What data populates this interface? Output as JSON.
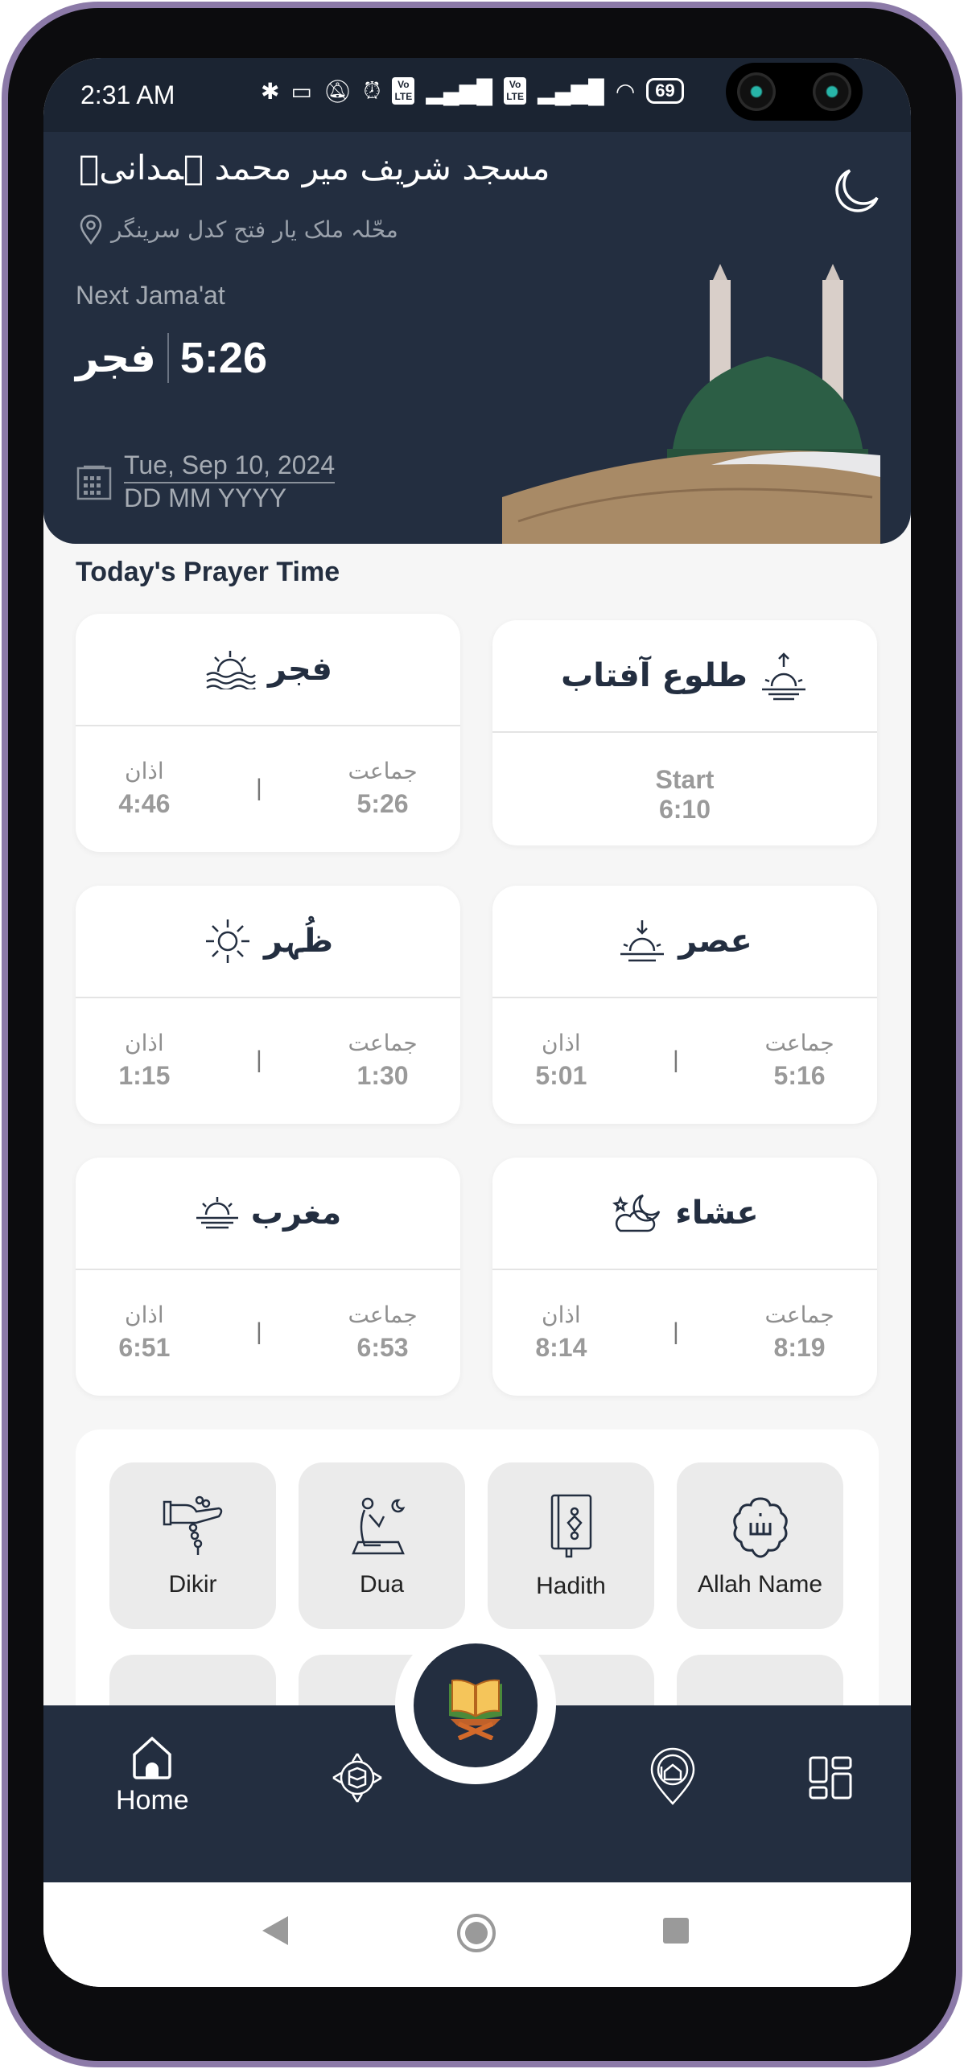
{
  "status_bar": {
    "time": "2:31 AM",
    "battery": "69",
    "volte": "Vo LTE"
  },
  "header": {
    "mosque_name": "مسجد شریف میر محمد ہمدانیؒ",
    "location": "محّلہ ملک یار فتح  کدل سرینگر",
    "next_label": "Next Jama'at",
    "next_prayer": "فجر",
    "next_time": "5:26",
    "date": "Tue, Sep 10, 2024",
    "date_format": "DD MM YYYY",
    "theme_icon": "moon-icon"
  },
  "section_title": "Today's Prayer Time",
  "prayers": [
    {
      "name": "فجر",
      "icon": "sunrise-waves-icon",
      "adhan_label": "اذان",
      "adhan": "4:46",
      "jamaat_label": "جماعت",
      "jamaat": "5:26"
    },
    {
      "name": "طلوع آفتاب",
      "icon": "sunrise-arrow-icon",
      "start_label": "Start",
      "start": "6:10"
    },
    {
      "name": "ظُہر",
      "icon": "sun-icon",
      "adhan_label": "اذان",
      "adhan": "1:15",
      "jamaat_label": "جماعت",
      "jamaat": "1:30"
    },
    {
      "name": "عصر",
      "icon": "sunset-arrow-icon",
      "adhan_label": "اذان",
      "adhan": "5:01",
      "jamaat_label": "جماعت",
      "jamaat": "5:16"
    },
    {
      "name": "مغرب",
      "icon": "sunset-icon",
      "adhan_label": "اذان",
      "adhan": "6:51",
      "jamaat_label": "جماعت",
      "jamaat": "6:53"
    },
    {
      "name": "عشاء",
      "icon": "moon-stars-cloud-icon",
      "adhan_label": "اذان",
      "adhan": "8:14",
      "jamaat_label": "جماعت",
      "jamaat": "8:19"
    }
  ],
  "features": [
    {
      "label": "Dikir",
      "icon": "tasbih-hand-icon"
    },
    {
      "label": "Dua",
      "icon": "praying-person-icon"
    },
    {
      "label": "Hadith",
      "icon": "book-icon"
    },
    {
      "label": "Allah Name",
      "icon": "allah-calligraphy-icon"
    }
  ],
  "bottom_nav": {
    "home_label": "Home",
    "items": [
      "home-icon",
      "qibla-compass-icon",
      "quran-icon",
      "mosque-location-icon",
      "dashboard-icon"
    ]
  },
  "colors": {
    "primary": "#232e40",
    "background": "#f6f6f6",
    "tile": "#ebebeb"
  }
}
